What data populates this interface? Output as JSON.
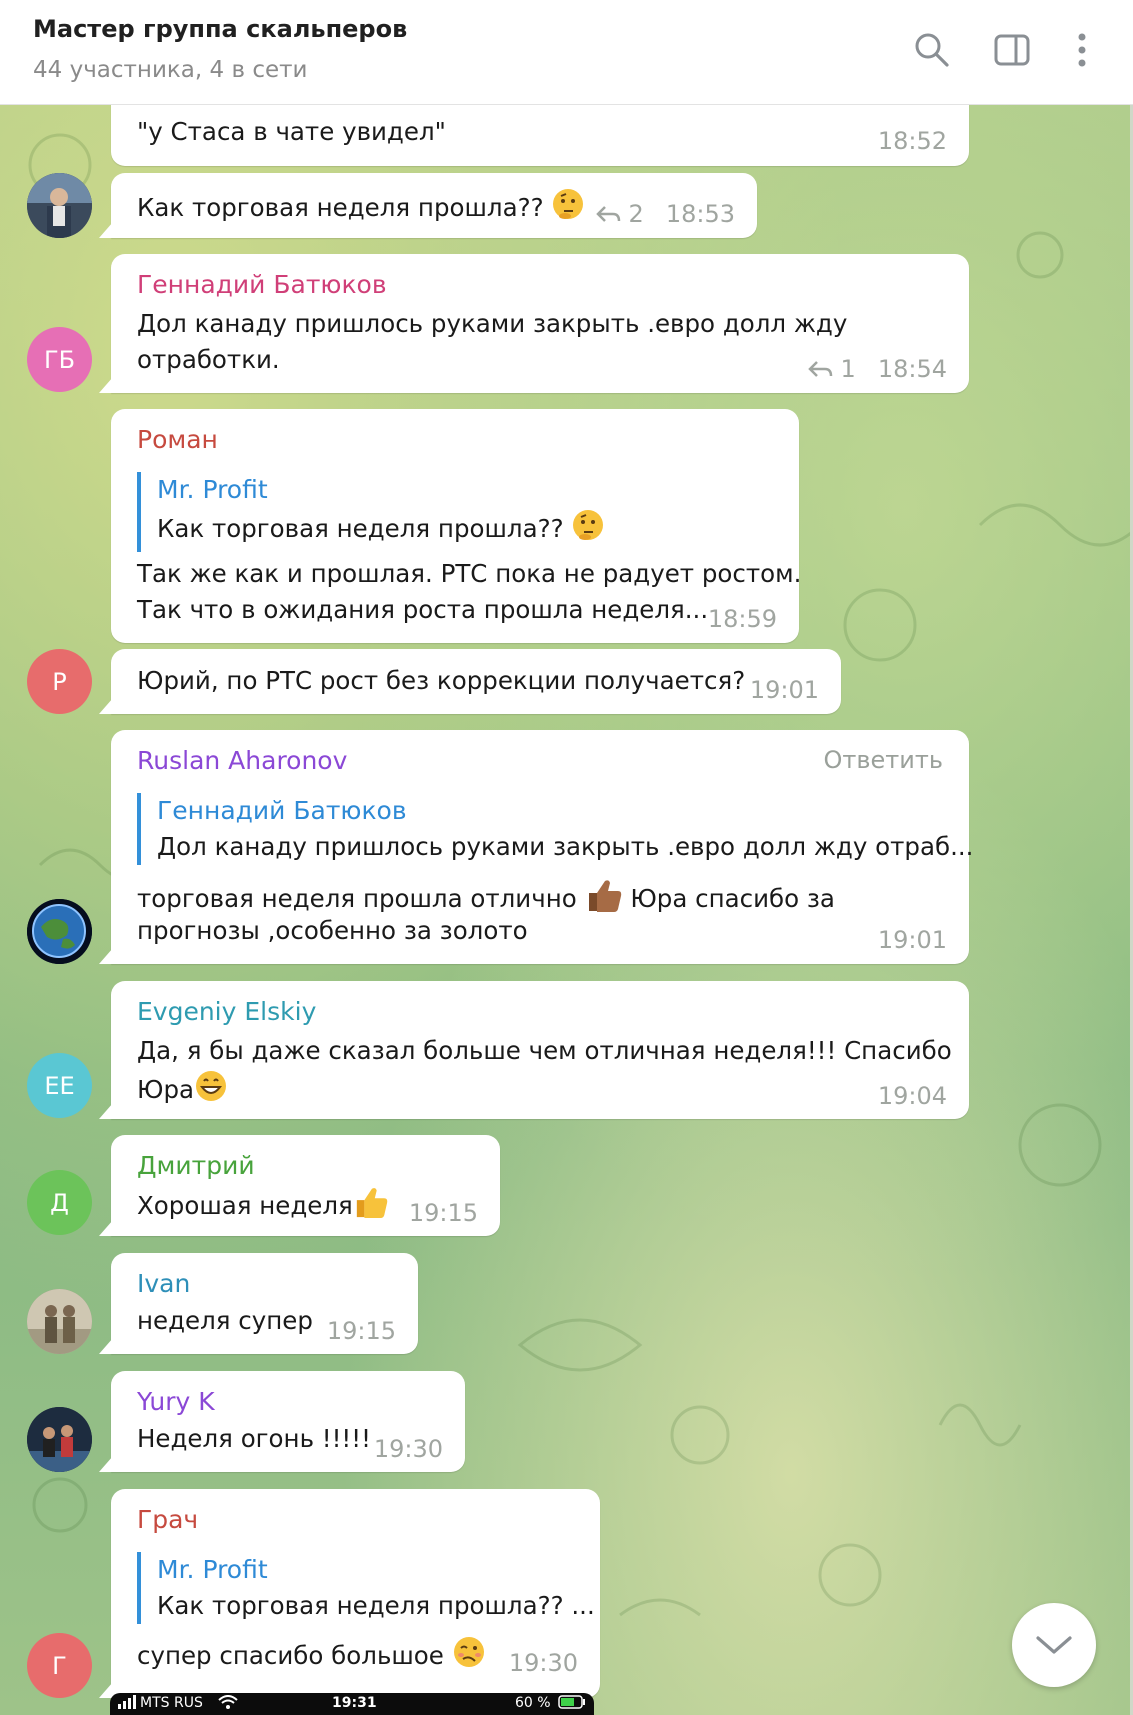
{
  "header": {
    "title": "Мастер группа скальперов",
    "subtitle": "44 участника, 4 в сети"
  },
  "messages": [
    {
      "text": "\"у Стаса в чате увидел\"",
      "time": "18:52"
    },
    {
      "text": "Как торговая неделя прошла??",
      "emoji": "thinking-emoji",
      "replies": "2",
      "time": "18:53"
    },
    {
      "avatar_initials": "ГБ",
      "avatar_color": "#e66fb5",
      "sender": "Геннадий Батюков",
      "sender_color": "#d03f78",
      "lines": [
        "Дол канаду пришлось руками закрыть .евро долл жду",
        "отработки."
      ],
      "replies": "1",
      "time": "18:54"
    },
    {
      "sender": "Роман",
      "sender_color": "#c64a3f",
      "quote": {
        "name": "Mr. Profit",
        "text": "Как торговая неделя прошла??"
      },
      "lines": [
        "Так же как и прошлая. РТС пока не радует ростом.",
        "Так что в ожидания роста прошла неделя..."
      ],
      "time": "18:59"
    },
    {
      "avatar_initials": "Р",
      "avatar_color": "#e76c6c",
      "text": "Юрий, по РТС рост без коррекции получается?",
      "time": "19:01"
    },
    {
      "sender": "Ruslan Aharonov",
      "sender_color": "#8b48d6",
      "reply_label": "Ответить",
      "quote": {
        "name": "Геннадий Батюков",
        "text": "Дол канаду пришлось руками закрыть .евро долл жду отраб..."
      },
      "lines": [
        "торговая неделя прошла отлично",
        "Юра спасибо за",
        "прогнозы ,особенно за золото"
      ],
      "time": "19:01"
    },
    {
      "avatar_initials": "ЕЕ",
      "avatar_color": "#5ac7d3",
      "sender": "Evgeniy Elskiy",
      "sender_color": "#2e9bb0",
      "lines": [
        "Да, я бы даже сказал больше чем отличная неделя!!! Спасибо",
        "Юра"
      ],
      "time": "19:04"
    },
    {
      "avatar_initials": "Д",
      "avatar_color": "#6cc35a",
      "sender": "Дмитрий",
      "sender_color": "#48a33c",
      "text": "Хорошая неделя",
      "time": "19:15"
    },
    {
      "sender": "Ivan",
      "sender_color": "#2e8fb8",
      "text": "неделя супер",
      "time": "19:15"
    },
    {
      "sender": "Yury K",
      "sender_color": "#8b48d6",
      "text": "Неделя огонь !!!!!",
      "time": "19:30"
    },
    {
      "avatar_initials": "Г",
      "avatar_color": "#e76c6c",
      "sender": "Грач",
      "sender_color": "#c64a3f",
      "quote": {
        "name": "Mr. Profit",
        "text": "Как торговая неделя прошла?? ..."
      },
      "text": "супер спасибо большое",
      "time": "19:30"
    }
  ],
  "phone_status": {
    "carrier": "MTS RUS",
    "time": "19:31",
    "battery": "60 %"
  }
}
